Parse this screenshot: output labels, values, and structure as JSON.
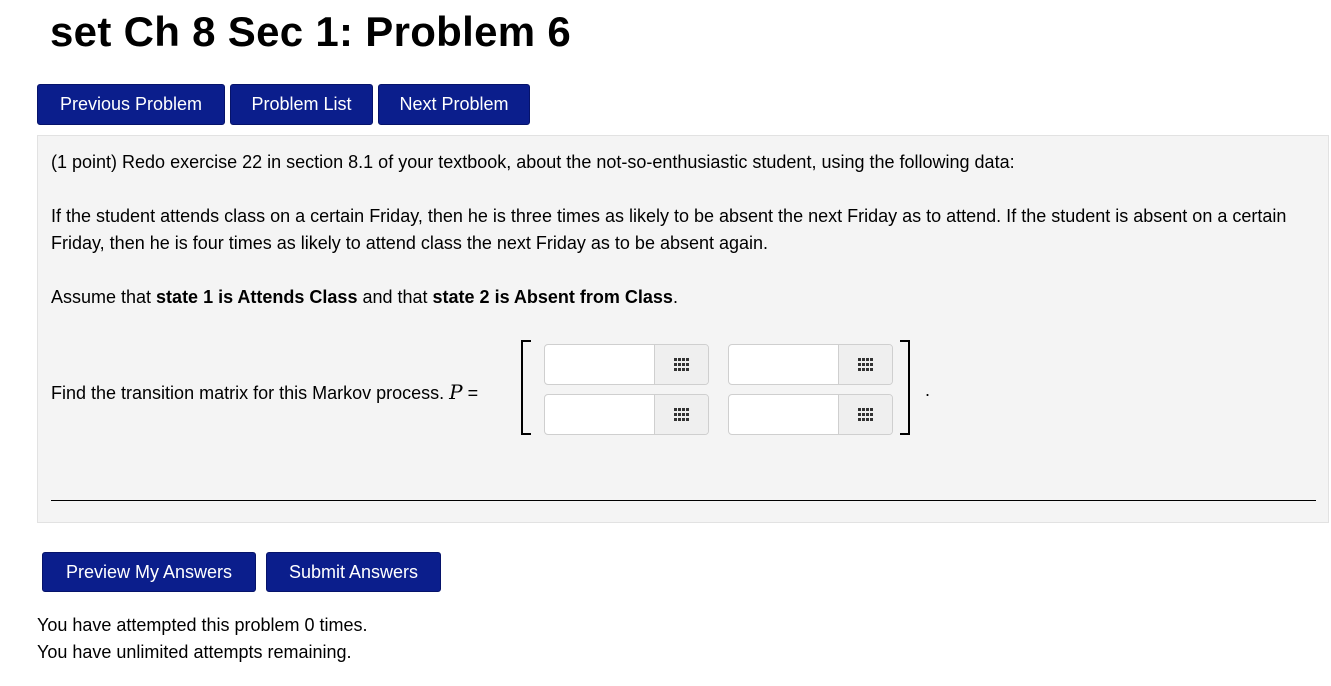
{
  "page": {
    "title": "set Ch 8 Sec 1: Problem 6"
  },
  "nav": {
    "previous_label": "Previous Problem",
    "list_label": "Problem List",
    "next_label": "Next Problem"
  },
  "problem": {
    "intro": "(1 point) Redo exercise 22 in section 8.1 of your textbook, about the not-so-enthusiastic student, using the following data:",
    "scenario": "If the student attends class on a certain Friday, then he is three times as likely to be absent the next Friday as to attend. If the student is absent on a certain Friday, then he is four times as likely to attend class the next Friday as to be absent again.",
    "assume_prefix": "Assume that ",
    "state1": "state 1 is Attends Class",
    "assume_middle": " and that ",
    "state2": "state 2 is Absent from Class",
    "assume_suffix": ".",
    "matrix_prompt": "Find the transition matrix for this Markov process.",
    "matrix_var": "P",
    "equals": "=",
    "period": ".",
    "matrix_cells": [
      {
        "value": "",
        "placeholder": ""
      },
      {
        "value": "",
        "placeholder": ""
      },
      {
        "value": "",
        "placeholder": ""
      },
      {
        "value": "",
        "placeholder": ""
      }
    ],
    "equation_editor_icon": "grid-icon"
  },
  "actions": {
    "preview_label": "Preview My Answers",
    "submit_label": "Submit Answers"
  },
  "status": {
    "attempts_line": "You have attempted this problem 0 times.",
    "remaining_line": "You have unlimited attempts remaining."
  },
  "colors": {
    "button_bg": "#0b1e8c",
    "panel_bg": "#f4f4f4"
  }
}
